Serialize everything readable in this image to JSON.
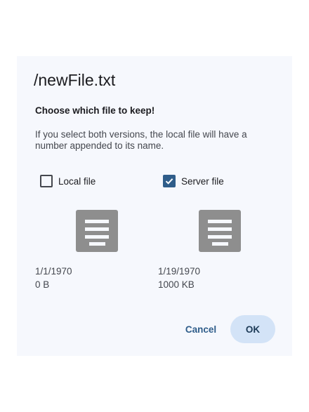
{
  "dialog": {
    "title": "/newFile.txt",
    "subtitle": "Choose which file to keep!",
    "description": "If you select both versions, the local file will have a number appended to its name.",
    "local": {
      "label": "Local file",
      "checked": false,
      "icon": "document-icon",
      "date": "1/1/1970",
      "size": "0 B"
    },
    "server": {
      "label": "Server file",
      "checked": true,
      "icon": "document-icon",
      "date": "1/19/1970",
      "size": "1000 KB"
    },
    "buttons": {
      "cancel": "Cancel",
      "ok": "OK"
    },
    "colors": {
      "accent": "#2f5d8a",
      "ok_button_bg": "#d3e3f7",
      "dialog_bg": "#f6f8fd",
      "icon_gray": "#8e8e8e"
    }
  }
}
